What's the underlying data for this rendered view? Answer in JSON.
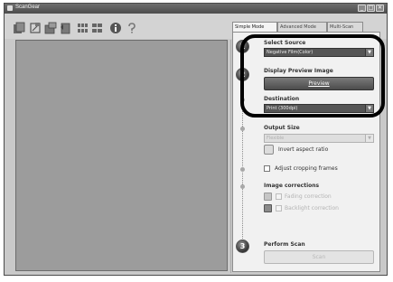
{
  "window": {
    "title": "ScanGear"
  },
  "titlebar_buttons": {
    "minimize": "_",
    "maximize": "□",
    "close": "✕"
  },
  "toolbar": {
    "icons": [
      "scan-thumbnail-icon",
      "auto-crop-icon",
      "clear-frame-icon",
      "rotate-left-icon",
      "rotate-right-icon",
      "grid-view-icon",
      "thumbnail-grid-icon",
      "info-icon",
      "help-icon"
    ],
    "info_glyph": "i",
    "help_glyph": "?"
  },
  "tabs": [
    {
      "label": "Simple Mode",
      "active": true
    },
    {
      "label": "Advanced Mode",
      "active": false
    },
    {
      "label": "Multi-Scan",
      "active": false
    }
  ],
  "steps": {
    "select_source": {
      "number": "1",
      "label": "Select Source",
      "value": "Negative Film(Color)"
    },
    "display_preview": {
      "number": "2",
      "label": "Display Preview Image",
      "button_label": "Preview"
    },
    "destination": {
      "label": "Destination",
      "value": "Print (300dpi)"
    },
    "output_size": {
      "label": "Output Size",
      "value": "Flexible",
      "invert_aspect_label": "Invert aspect ratio"
    },
    "cropping": {
      "label": "Adjust cropping frames"
    },
    "image_corrections": {
      "label": "Image corrections",
      "fading_label": "Fading correction",
      "backlight_label": "Backlight correction"
    },
    "perform_scan": {
      "number": "3",
      "label": "Perform Scan",
      "button_label": "Scan"
    }
  },
  "colors": {
    "preview_area": "#9c9c9c",
    "highlight_border": "#000000"
  }
}
